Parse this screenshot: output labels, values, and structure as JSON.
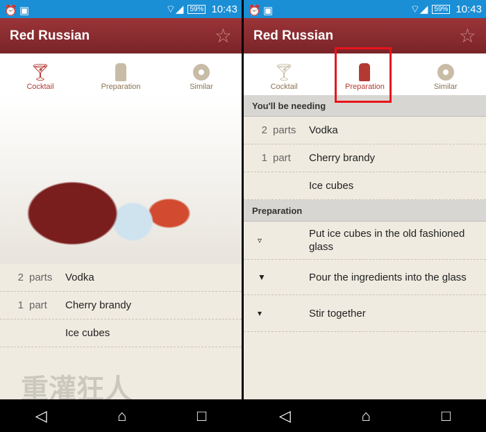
{
  "status": {
    "time": "10:43",
    "battery": "59%"
  },
  "title": "Red Russian",
  "tabs": [
    "Cocktail",
    "Preparation",
    "Similar"
  ],
  "ingredients": [
    {
      "n": "2",
      "u": "parts",
      "name": "Vodka"
    },
    {
      "n": "1",
      "u": "part",
      "name": "Cherry brandy"
    },
    {
      "n": "",
      "u": "",
      "name": "Ice cubes"
    }
  ],
  "sections": {
    "needing": "You'll be needing",
    "preparation": "Preparation"
  },
  "steps": [
    "Put ice cubes in the old fashioned glass",
    "Pour the ingredients into the glass",
    "Stir together"
  ],
  "watermark": "重灌狂人 HTTP://BRIIAN.COM",
  "colors": {
    "status": "#1b8fd6",
    "appbar": "#8b2c30",
    "active_tab": "#b33a32",
    "highlight": "#e8141a"
  }
}
